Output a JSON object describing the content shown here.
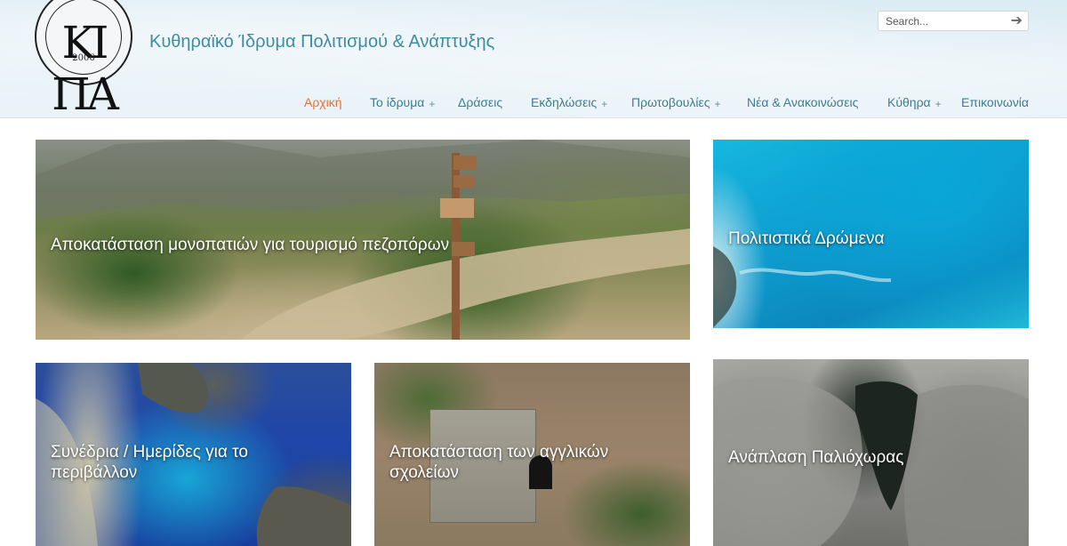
{
  "site": {
    "logo_letters": "ΚΙ ΠΑ",
    "logo_year": "2006",
    "title": "Κυθηραϊκό Ίδρυμα Πολιτισμού & Ανάπτυξης"
  },
  "search": {
    "placeholder": "Search...",
    "icon": "arrow-right-icon"
  },
  "nav": {
    "items": [
      {
        "label": "Αρχική",
        "active": true,
        "has_submenu": false
      },
      {
        "label": "Το ίδρυμα",
        "active": false,
        "has_submenu": true
      },
      {
        "label": "Δράσεις",
        "active": false,
        "has_submenu": false
      },
      {
        "label": "Εκδηλώσεις",
        "active": false,
        "has_submenu": true
      },
      {
        "label": "Πρωτοβουλίες",
        "active": false,
        "has_submenu": true
      },
      {
        "label": "Νέα & Ανακοινώσεις",
        "active": false,
        "has_submenu": false
      },
      {
        "label": "Κύθηρα",
        "active": false,
        "has_submenu": true
      },
      {
        "label": "Επικοινωνία",
        "active": false,
        "has_submenu": false
      }
    ],
    "submenu_marker": "+"
  },
  "cards": [
    {
      "title": "Αποκατάσταση μονοπατιών για τουρισμό πεζοπόρων"
    },
    {
      "title": "Πολιτιστικά Δρώμενα"
    },
    {
      "title": "Συνέδρια / Ημερίδες για το περιβάλλον"
    },
    {
      "title": "Αποκατάσταση των αγγλικών σχολείων"
    },
    {
      "title": "Ανάπλαση Παλιόχωρας"
    }
  ],
  "colors": {
    "accent_active": "#e8722e",
    "nav_text": "#3e7d8e",
    "title_text": "#3e8ca0"
  }
}
